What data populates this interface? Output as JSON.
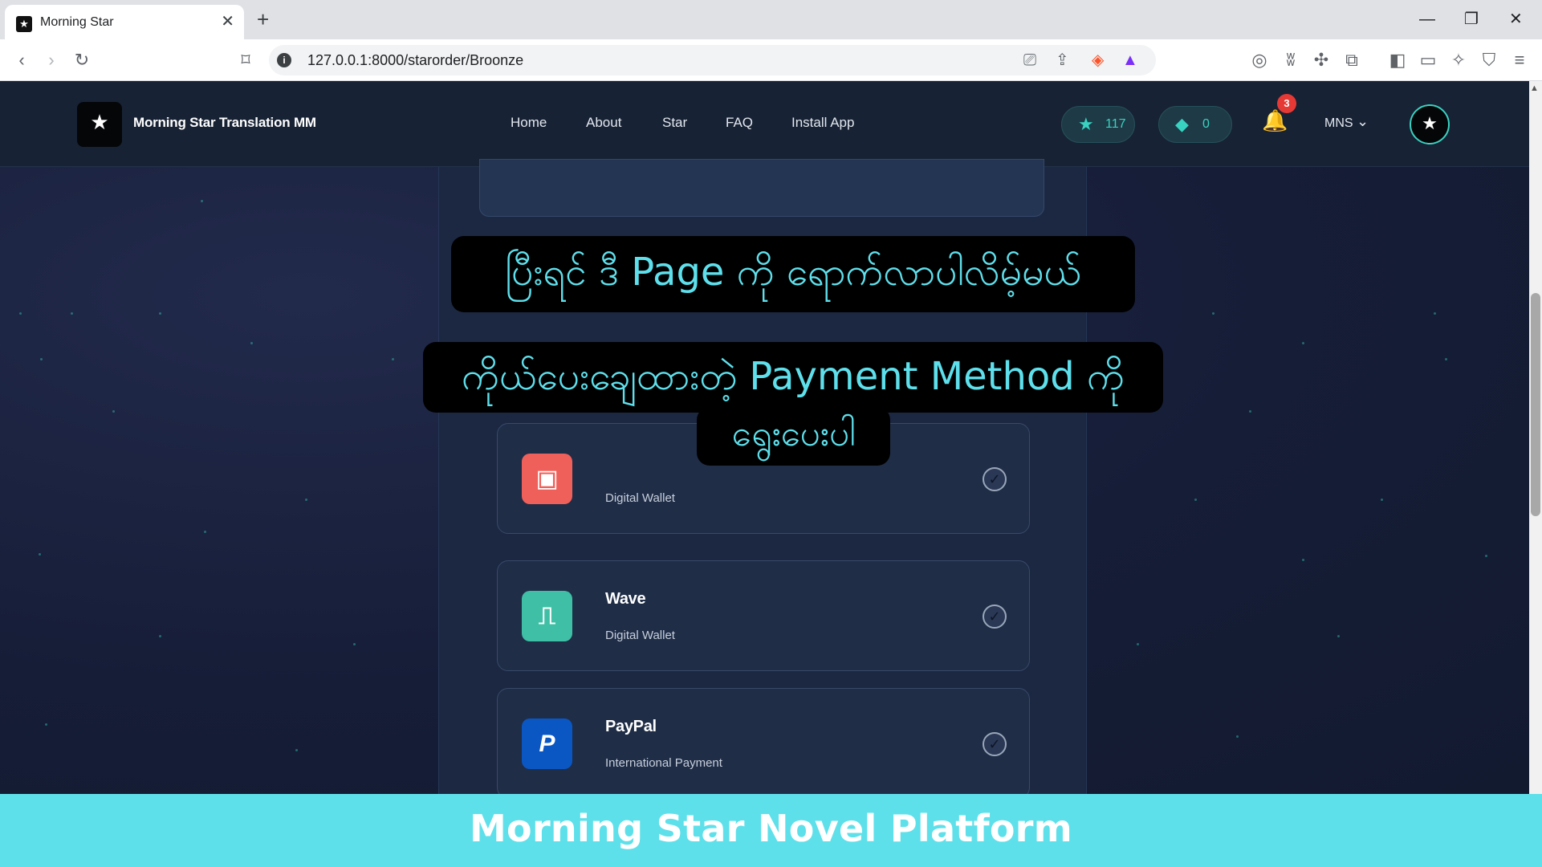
{
  "browser": {
    "tab_title": "Morning Star",
    "url": "127.0.0.1:8000/starorder/Broonze"
  },
  "navbar": {
    "brand": "Morning Star Translation MM",
    "links": [
      "Home",
      "About",
      "Star",
      "FAQ",
      "Install App"
    ],
    "stars": "117",
    "gems": "0",
    "notifications": "3",
    "language": "MNS"
  },
  "payments": [
    {
      "title": "",
      "subtitle": "Digital Wallet",
      "color": "#f0605a"
    },
    {
      "title": "Wave",
      "subtitle": "Digital Wallet",
      "color": "#3fbfa6"
    },
    {
      "title": "PayPal",
      "subtitle": "International Payment",
      "color": "#0a57c4"
    }
  ],
  "captions": {
    "line1": "ပြီးရင် ဒီ Page ကို ရောက်လာပါလိမ့်မယ်",
    "line2": "ကိုယ်ပေးချေထားတဲ့ Payment Method ကို",
    "line3": "ရွေးပေးပါ"
  },
  "footer": {
    "title": "Morning Star Novel Platform"
  },
  "colors": {
    "accent": "#39d2c0",
    "caption_text": "#5ee0ec",
    "footer_bg": "#5ee0ea"
  }
}
